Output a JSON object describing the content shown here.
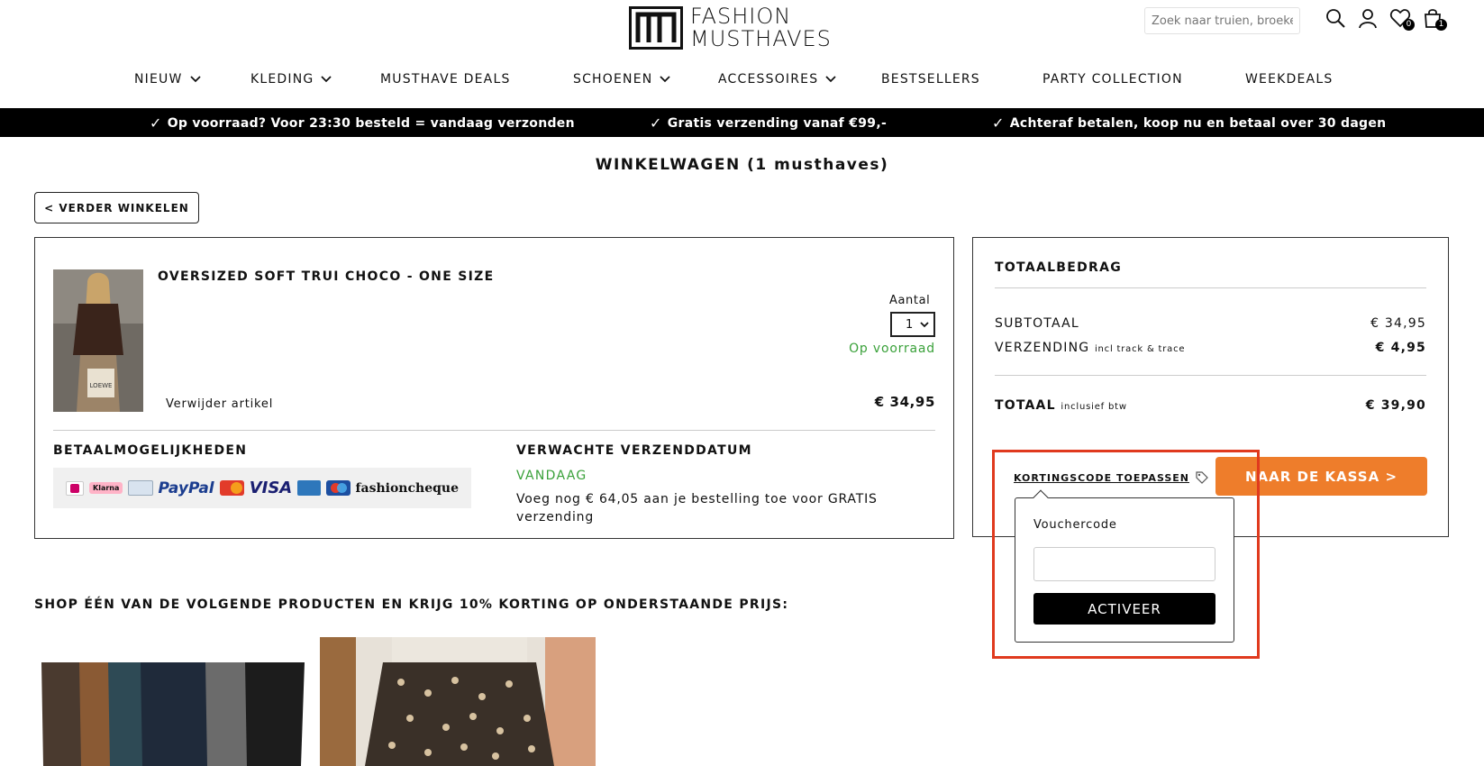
{
  "header": {
    "logo_line1": "FASHION",
    "logo_line2": "MUSTHAVES",
    "search_placeholder": "Zoek naar truien, broeken...",
    "wishlist_count": "0",
    "cart_count": "1"
  },
  "nav": {
    "items": [
      {
        "label": "NIEUW",
        "dropdown": true
      },
      {
        "label": "KLEDING",
        "dropdown": true
      },
      {
        "label": "MUSTHAVE DEALS",
        "dropdown": false
      },
      {
        "label": "SCHOENEN",
        "dropdown": true
      },
      {
        "label": "ACCESSOIRES",
        "dropdown": true
      },
      {
        "label": "BESTSELLERS",
        "dropdown": false
      },
      {
        "label": "PARTY COLLECTION",
        "dropdown": false
      },
      {
        "label": "WEEKDEALS",
        "dropdown": false
      }
    ]
  },
  "usp": {
    "items": [
      "Op voorraad? Voor 23:30 besteld = vandaag verzonden",
      "Gratis verzending vanaf €99,-",
      "Achteraf betalen, koop nu en betaal over 30 dagen"
    ]
  },
  "page": {
    "title": "WINKELWAGEN (1 musthaves)",
    "back_button": "< VERDER WINKELEN"
  },
  "cart": {
    "product_name": "OVERSIZED SOFT TRUI CHOCO - ONE SIZE",
    "quantity_label": "Aantal",
    "quantity_value": "1",
    "stock_status": "Op voorraad",
    "remove_label": "Verwijder artikel",
    "line_price": "€ 34,95",
    "payment_title": "BETAALMOGELIJKHEDEN",
    "payment_methods": [
      "iDEAL",
      "Klarna",
      "Bank",
      "PayPal",
      "Mastercard",
      "VISA",
      "Amex",
      "Maestro",
      "fashioncheque"
    ],
    "shipping_title": "VERWACHTE VERZENDDATUM",
    "shipping_day": "VANDAAG",
    "shipping_note": "Voeg nog € 64,05 aan je bestelling toe voor GRATIS verzending"
  },
  "totals": {
    "title": "TOTAALBEDRAG",
    "subtotal_label": "SUBTOTAAL",
    "subtotal_value": "€ 34,95",
    "shipping_label": "VERZENDING",
    "shipping_sub": "incl track & trace",
    "shipping_value": "€ 4,95",
    "total_label": "TOTAAL",
    "total_sub": "inclusief btw",
    "total_value": "€ 39,90",
    "coupon_link": "KORTINGSCODE TOEPASSEN",
    "checkout_button": "NAAR DE KASSA >"
  },
  "voucher": {
    "label": "Vouchercode",
    "input_value": "",
    "button": "ACTIVEER"
  },
  "upsell": {
    "title": "SHOP ÉÉN VAN DE VOLGENDE PRODUCTEN EN KRIJG 10% KORTING OP ONDERSTAANDE PRIJS:"
  },
  "colors": {
    "accent_orange": "#ee7d2b",
    "in_stock_green": "#3aa13a",
    "highlight_red": "#e03a1e"
  }
}
